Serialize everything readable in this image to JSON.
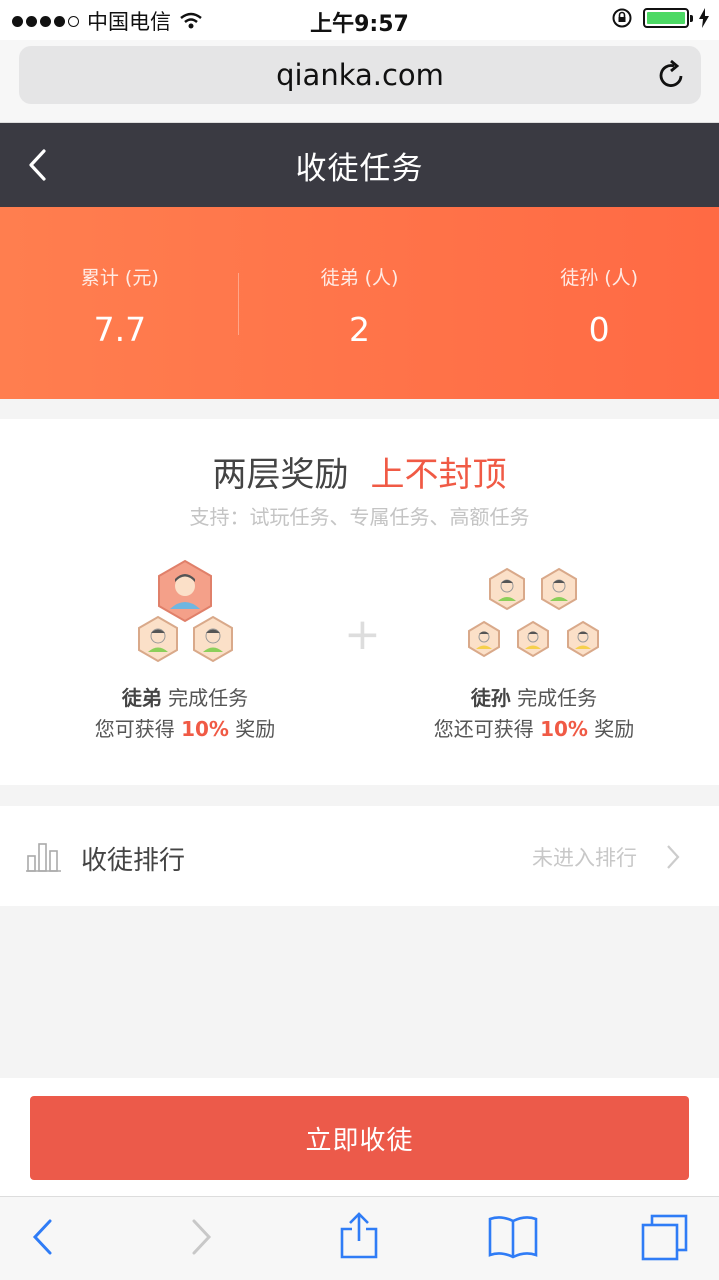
{
  "status_bar": {
    "carrier": "中国电信",
    "time": "上午9:57"
  },
  "browser": {
    "url": "qianka.com"
  },
  "nav": {
    "title": "收徒任务"
  },
  "stats": [
    {
      "label": "累计 (元)",
      "value": "7.7"
    },
    {
      "label": "徒弟 (人)",
      "value": "2"
    },
    {
      "label": "徒孙 (人)",
      "value": "0"
    }
  ],
  "rewards": {
    "title": "两层奖励",
    "title_highlight": "上不封顶",
    "subtitle": "支持：试玩任务、专属任务、高额任务",
    "tiers": [
      {
        "who": "徒弟",
        "action": "完成任务",
        "gain_prefix": "您可获得",
        "percent": "10%",
        "gain_suffix": "奖励"
      },
      {
        "who": "徒孙",
        "action": "完成任务",
        "gain_prefix": "您还可获得",
        "percent": "10%",
        "gain_suffix": "奖励"
      }
    ],
    "plus": "+"
  },
  "ranking": {
    "label": "收徒排行",
    "status": "未进入排行"
  },
  "cta": {
    "label": "立即收徒"
  },
  "colors": {
    "accent": "#ec5a4a",
    "highlight": "#f05a45",
    "header_bg": "#3a3a42",
    "stats_gradient_start": "#ff7e4f",
    "stats_gradient_end": "#ff6a44",
    "ios_blue": "#2f7cf6"
  }
}
